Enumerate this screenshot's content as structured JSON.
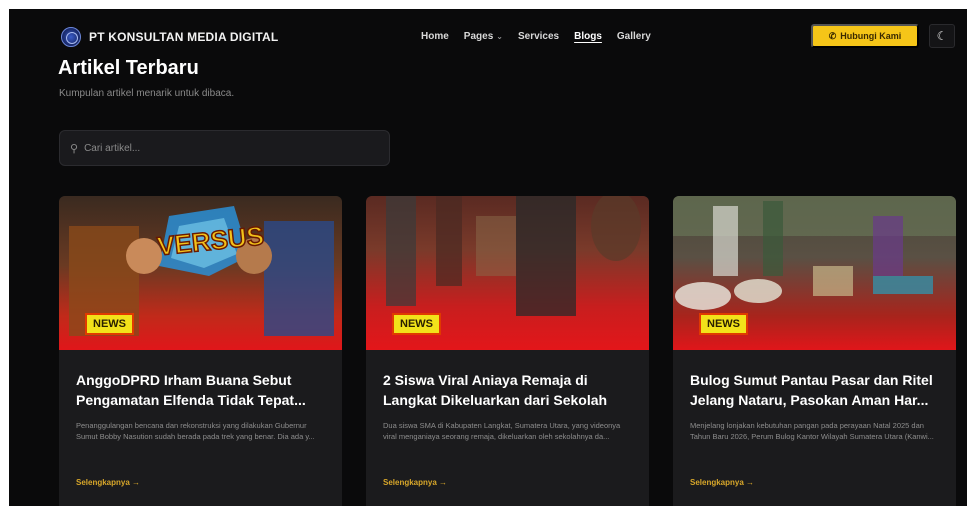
{
  "header": {
    "brand": "PT KONSULTAN MEDIA DIGITAL",
    "nav": [
      {
        "label": "Home"
      },
      {
        "label": "Pages"
      },
      {
        "label": "Services"
      },
      {
        "label": "Blogs"
      },
      {
        "label": "Gallery"
      }
    ],
    "cta_label": "Hubungi Kami",
    "theme_icon": "moon-icon"
  },
  "hero": {
    "title": "Artikel Terbaru",
    "subtitle": "Kumpulan artikel menarik untuk dibaca."
  },
  "search": {
    "placeholder": "Cari artikel..."
  },
  "articles": [
    {
      "badge": "NEWS",
      "overlay_text": "VERSUS",
      "title": "AnggoDPRD Irham Buana Sebut Pengamatan Elfenda Tidak Tepat...",
      "excerpt": "Penanggulangan bencana dan rekonstruksi yang dilakukan Gubernur Sumut Bobby Nasution sudah berada pada trek yang benar. Dia ada y...",
      "more": "Selengkapnya →"
    },
    {
      "badge": "NEWS",
      "title": "2 Siswa Viral Aniaya Remaja di Langkat Dikeluarkan dari Sekolah",
      "excerpt": "Dua siswa SMA di Kabupaten Langkat, Sumatera Utara, yang videonya viral menganiaya seorang remaja, dikeluarkan oleh sekolahnya da...",
      "more": "Selengkapnya →"
    },
    {
      "badge": "NEWS",
      "title": "Bulog Sumut Pantau Pasar dan Ritel Jelang Nataru, Pasokan Aman Har...",
      "excerpt": "Menjelang lonjakan kebutuhan pangan pada perayaan Natal 2025 dan Tahun Baru 2026, Perum Bulog Kantor Wilayah Sumatera Utara (Kanwi...",
      "more": "Selengkapnya →"
    }
  ],
  "colors": {
    "accent": "#f5c518",
    "badge": "#f2e21a",
    "background": "#0a0a0b",
    "card": "#1b1b1d"
  }
}
